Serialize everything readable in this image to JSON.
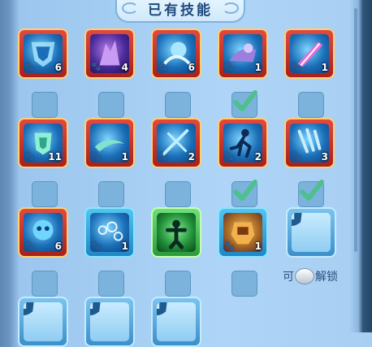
{
  "title": "已有技能",
  "unlock_text": {
    "prefix": "可",
    "suffix": "解锁"
  },
  "skills": [
    {
      "id": "s1",
      "level": "6",
      "checked": false,
      "frame": "red"
    },
    {
      "id": "s2",
      "level": "4",
      "checked": false,
      "frame": "red"
    },
    {
      "id": "s3",
      "level": "6",
      "checked": false,
      "frame": "red"
    },
    {
      "id": "s4",
      "level": "1",
      "checked": true,
      "frame": "red"
    },
    {
      "id": "s5",
      "level": "1",
      "checked": false,
      "frame": "red"
    },
    {
      "id": "s6",
      "level": "11",
      "checked": false,
      "frame": "red"
    },
    {
      "id": "s7",
      "level": "1",
      "checked": false,
      "frame": "red"
    },
    {
      "id": "s8",
      "level": "2",
      "checked": false,
      "frame": "red"
    },
    {
      "id": "s9",
      "level": "2",
      "checked": true,
      "frame": "red"
    },
    {
      "id": "s10",
      "level": "3",
      "checked": true,
      "frame": "red"
    },
    {
      "id": "s11",
      "level": "6",
      "checked": false,
      "frame": "red"
    },
    {
      "id": "s12",
      "level": "1",
      "checked": false,
      "frame": "blue"
    },
    {
      "id": "s13",
      "level": "",
      "checked": false,
      "frame": "green"
    },
    {
      "id": "s14",
      "level": "1",
      "checked": false,
      "frame": "blue"
    }
  ],
  "colors": {
    "check": "#4fbf8f",
    "title_text": "#1f4a7d",
    "paw": "#ffb33c"
  },
  "icons": {
    "paw": "paw-icon",
    "check": "checkmark-icon",
    "lock": "lock-icon",
    "coin": "coin-icon"
  }
}
